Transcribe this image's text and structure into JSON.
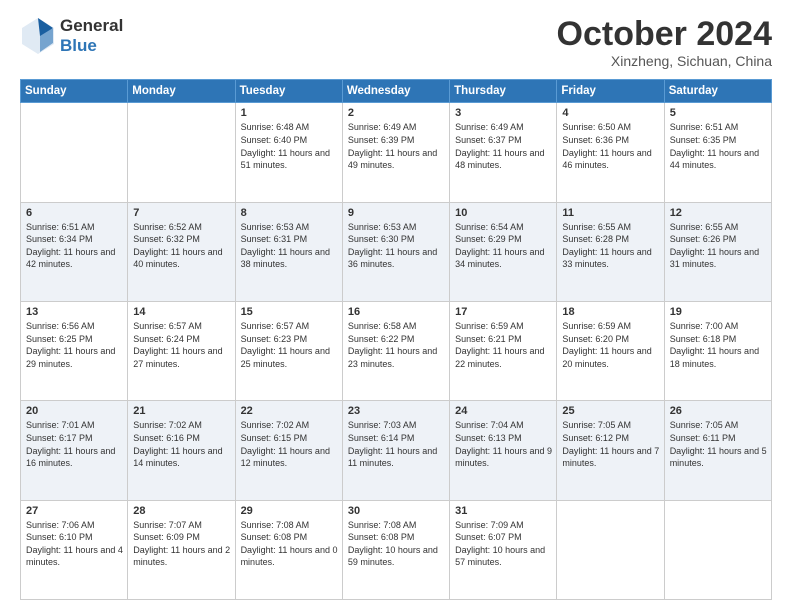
{
  "header": {
    "logo_line1": "General",
    "logo_line2": "Blue",
    "month_title": "October 2024",
    "location": "Xinzheng, Sichuan, China"
  },
  "weekdays": [
    "Sunday",
    "Monday",
    "Tuesday",
    "Wednesday",
    "Thursday",
    "Friday",
    "Saturday"
  ],
  "weeks": [
    [
      {
        "day": "",
        "text": ""
      },
      {
        "day": "",
        "text": ""
      },
      {
        "day": "1",
        "text": "Sunrise: 6:48 AM\nSunset: 6:40 PM\nDaylight: 11 hours and 51 minutes."
      },
      {
        "day": "2",
        "text": "Sunrise: 6:49 AM\nSunset: 6:39 PM\nDaylight: 11 hours and 49 minutes."
      },
      {
        "day": "3",
        "text": "Sunrise: 6:49 AM\nSunset: 6:37 PM\nDaylight: 11 hours and 48 minutes."
      },
      {
        "day": "4",
        "text": "Sunrise: 6:50 AM\nSunset: 6:36 PM\nDaylight: 11 hours and 46 minutes."
      },
      {
        "day": "5",
        "text": "Sunrise: 6:51 AM\nSunset: 6:35 PM\nDaylight: 11 hours and 44 minutes."
      }
    ],
    [
      {
        "day": "6",
        "text": "Sunrise: 6:51 AM\nSunset: 6:34 PM\nDaylight: 11 hours and 42 minutes."
      },
      {
        "day": "7",
        "text": "Sunrise: 6:52 AM\nSunset: 6:32 PM\nDaylight: 11 hours and 40 minutes."
      },
      {
        "day": "8",
        "text": "Sunrise: 6:53 AM\nSunset: 6:31 PM\nDaylight: 11 hours and 38 minutes."
      },
      {
        "day": "9",
        "text": "Sunrise: 6:53 AM\nSunset: 6:30 PM\nDaylight: 11 hours and 36 minutes."
      },
      {
        "day": "10",
        "text": "Sunrise: 6:54 AM\nSunset: 6:29 PM\nDaylight: 11 hours and 34 minutes."
      },
      {
        "day": "11",
        "text": "Sunrise: 6:55 AM\nSunset: 6:28 PM\nDaylight: 11 hours and 33 minutes."
      },
      {
        "day": "12",
        "text": "Sunrise: 6:55 AM\nSunset: 6:26 PM\nDaylight: 11 hours and 31 minutes."
      }
    ],
    [
      {
        "day": "13",
        "text": "Sunrise: 6:56 AM\nSunset: 6:25 PM\nDaylight: 11 hours and 29 minutes."
      },
      {
        "day": "14",
        "text": "Sunrise: 6:57 AM\nSunset: 6:24 PM\nDaylight: 11 hours and 27 minutes."
      },
      {
        "day": "15",
        "text": "Sunrise: 6:57 AM\nSunset: 6:23 PM\nDaylight: 11 hours and 25 minutes."
      },
      {
        "day": "16",
        "text": "Sunrise: 6:58 AM\nSunset: 6:22 PM\nDaylight: 11 hours and 23 minutes."
      },
      {
        "day": "17",
        "text": "Sunrise: 6:59 AM\nSunset: 6:21 PM\nDaylight: 11 hours and 22 minutes."
      },
      {
        "day": "18",
        "text": "Sunrise: 6:59 AM\nSunset: 6:20 PM\nDaylight: 11 hours and 20 minutes."
      },
      {
        "day": "19",
        "text": "Sunrise: 7:00 AM\nSunset: 6:18 PM\nDaylight: 11 hours and 18 minutes."
      }
    ],
    [
      {
        "day": "20",
        "text": "Sunrise: 7:01 AM\nSunset: 6:17 PM\nDaylight: 11 hours and 16 minutes."
      },
      {
        "day": "21",
        "text": "Sunrise: 7:02 AM\nSunset: 6:16 PM\nDaylight: 11 hours and 14 minutes."
      },
      {
        "day": "22",
        "text": "Sunrise: 7:02 AM\nSunset: 6:15 PM\nDaylight: 11 hours and 12 minutes."
      },
      {
        "day": "23",
        "text": "Sunrise: 7:03 AM\nSunset: 6:14 PM\nDaylight: 11 hours and 11 minutes."
      },
      {
        "day": "24",
        "text": "Sunrise: 7:04 AM\nSunset: 6:13 PM\nDaylight: 11 hours and 9 minutes."
      },
      {
        "day": "25",
        "text": "Sunrise: 7:05 AM\nSunset: 6:12 PM\nDaylight: 11 hours and 7 minutes."
      },
      {
        "day": "26",
        "text": "Sunrise: 7:05 AM\nSunset: 6:11 PM\nDaylight: 11 hours and 5 minutes."
      }
    ],
    [
      {
        "day": "27",
        "text": "Sunrise: 7:06 AM\nSunset: 6:10 PM\nDaylight: 11 hours and 4 minutes."
      },
      {
        "day": "28",
        "text": "Sunrise: 7:07 AM\nSunset: 6:09 PM\nDaylight: 11 hours and 2 minutes."
      },
      {
        "day": "29",
        "text": "Sunrise: 7:08 AM\nSunset: 6:08 PM\nDaylight: 11 hours and 0 minutes."
      },
      {
        "day": "30",
        "text": "Sunrise: 7:08 AM\nSunset: 6:08 PM\nDaylight: 10 hours and 59 minutes."
      },
      {
        "day": "31",
        "text": "Sunrise: 7:09 AM\nSunset: 6:07 PM\nDaylight: 10 hours and 57 minutes."
      },
      {
        "day": "",
        "text": ""
      },
      {
        "day": "",
        "text": ""
      }
    ]
  ]
}
